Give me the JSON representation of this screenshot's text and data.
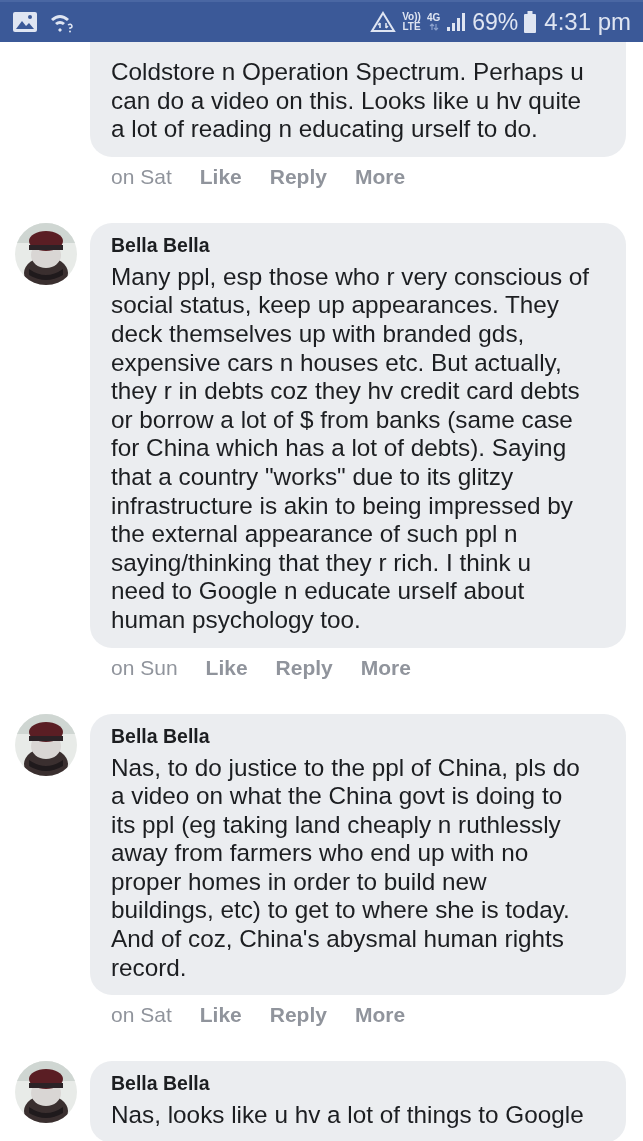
{
  "status_bar": {
    "volte": "Vo))",
    "lte": "LTE",
    "network": "4G",
    "battery": "69%",
    "time": "4:31 pm"
  },
  "comments": [
    {
      "has_avatar": false,
      "text": "Coldstore n Operation Spectrum. Perhaps u\ncan do a video on this. Looks like u hv quite\na lot of reading n educating urself to do.",
      "time": "on Sat",
      "actions": [
        "Like",
        "Reply",
        "More"
      ]
    },
    {
      "has_avatar": true,
      "author": "Bella Bella",
      "text": "Many ppl, esp those who r very conscious of\nsocial status, keep up appearances. They\ndeck themselves up with branded gds,\nexpensive cars n houses etc. But actually,\nthey r in debts coz they hv credit card debts\nor borrow a lot of $ from banks (same case\nfor China which has a lot of debts). Saying\nthat a country \"works\" due to its glitzy\ninfrastructure is akin to being impressed by\nthe external appearance of such ppl n\nsaying/thinking that they r rich. I think u\nneed to Google n educate urself about\nhuman psychology too.",
      "time": "on Sun",
      "actions": [
        "Like",
        "Reply",
        "More"
      ]
    },
    {
      "has_avatar": true,
      "author": "Bella Bella",
      "text": "Nas, to do justice to the ppl of China, pls do\na video on what the China govt is doing to\nits ppl (eg taking land cheaply n ruthlessly\naway from farmers who end up with no\nproper homes in order to build new\nbuildings, etc) to get to where she is today.\nAnd of coz, China's abysmal human rights\nrecord.",
      "time": "on Sat",
      "actions": [
        "Like",
        "Reply",
        "More"
      ]
    },
    {
      "has_avatar": true,
      "author": "Bella Bella",
      "text": "Nas, looks like u hv a lot of things to Google"
    }
  ]
}
